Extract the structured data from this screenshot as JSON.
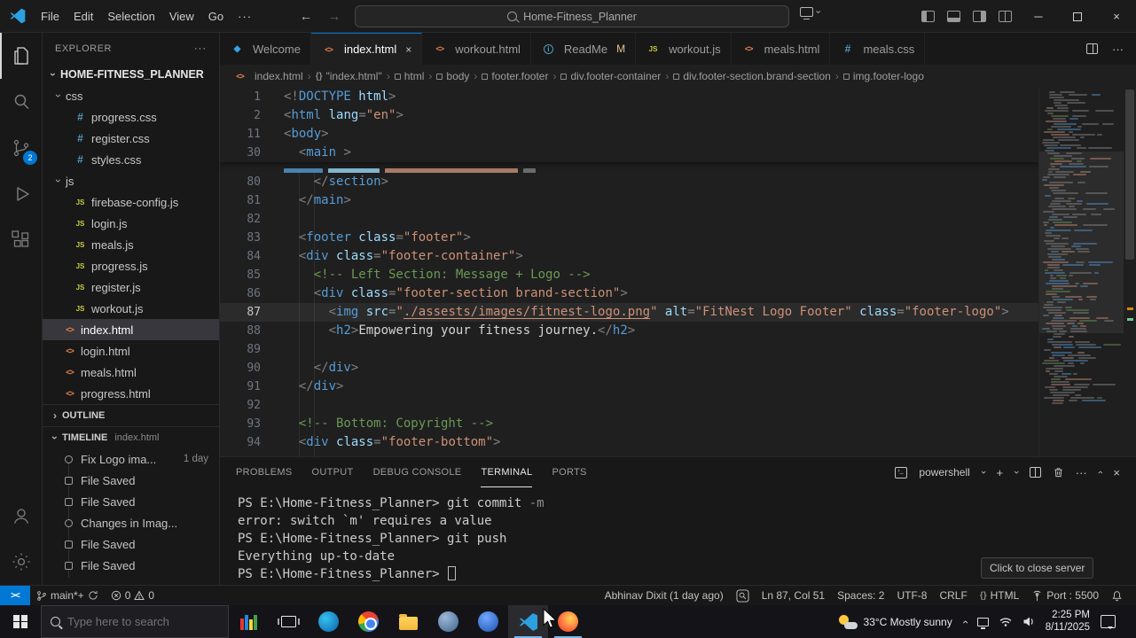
{
  "colors": {
    "accent": "#0078d4",
    "git_modified": "#e2c08d",
    "html_icon": "#e8824a",
    "css_icon": "#519aba",
    "js_icon": "#cbcb41",
    "remote_bg": "#0078d4",
    "selection_bg": "#37373d"
  },
  "titlebar": {
    "menus": [
      "File",
      "Edit",
      "Selection",
      "View",
      "Go"
    ],
    "overflow": "···",
    "back": "←",
    "forward": "→",
    "command_center": "Home-Fitness_Planner",
    "window": {
      "min": "─",
      "close": "×"
    }
  },
  "activitybar": {
    "scm_badge": "2"
  },
  "sidebar": {
    "header": "EXPLORER",
    "header_actions": "···",
    "root": "HOME-FITNESS_PLANNER",
    "files": [
      {
        "label": "css",
        "type": "folder",
        "expanded": true
      },
      {
        "label": "progress.css",
        "type": "css",
        "level": 2
      },
      {
        "label": "register.css",
        "type": "css",
        "level": 2
      },
      {
        "label": "styles.css",
        "type": "css",
        "level": 2
      },
      {
        "label": "js",
        "type": "folder",
        "expanded": true
      },
      {
        "label": "firebase-config.js",
        "type": "js",
        "level": 2
      },
      {
        "label": "login.js",
        "type": "js",
        "level": 2
      },
      {
        "label": "meals.js",
        "type": "js",
        "level": 2
      },
      {
        "label": "progress.js",
        "type": "js",
        "level": 2
      },
      {
        "label": "register.js",
        "type": "js",
        "level": 2
      },
      {
        "label": "workout.js",
        "type": "js",
        "level": 2
      },
      {
        "label": "index.html",
        "type": "html",
        "level": 1,
        "selected": true
      },
      {
        "label": "login.html",
        "type": "html",
        "level": 1
      },
      {
        "label": "meals.html",
        "type": "html",
        "level": 1
      },
      {
        "label": "progress.html",
        "type": "html",
        "level": 1
      }
    ],
    "outline_label": "OUTLINE",
    "timeline_label": "TIMELINE",
    "timeline_file": "index.html",
    "timeline_items": [
      {
        "label": "Fix Logo ima...",
        "time": "1 day",
        "icon": "commit"
      },
      {
        "label": "File Saved",
        "icon": "save"
      },
      {
        "label": "File Saved",
        "icon": "save"
      },
      {
        "label": "Changes in Imag...",
        "icon": "commit"
      },
      {
        "label": "File Saved",
        "icon": "save"
      },
      {
        "label": "File Saved",
        "icon": "save"
      }
    ]
  },
  "tabs": [
    {
      "label": "Welcome",
      "icon": "welcome"
    },
    {
      "label": "index.html",
      "icon": "html",
      "active": true,
      "close": true
    },
    {
      "label": "workout.html",
      "icon": "html"
    },
    {
      "label": "ReadMe",
      "icon": "info",
      "badge": "M"
    },
    {
      "label": "workout.js",
      "icon": "js"
    },
    {
      "label": "meals.html",
      "icon": "html"
    },
    {
      "label": "meals.css",
      "icon": "css"
    }
  ],
  "breadcrumbs": [
    {
      "icon": "html",
      "label": "index.html"
    },
    {
      "icon": "braces",
      "label": "\"index.html\""
    },
    {
      "icon": "sym",
      "label": "html"
    },
    {
      "icon": "sym",
      "label": "body"
    },
    {
      "icon": "sym",
      "label": "footer.footer"
    },
    {
      "icon": "sym",
      "label": "div.footer-container"
    },
    {
      "icon": "sym",
      "label": "div.footer-section.brand-section"
    },
    {
      "icon": "sym",
      "label": "img.footer-logo"
    }
  ],
  "editor": {
    "sticky": [
      {
        "n": "1",
        "s": [
          [
            "pt",
            "<!"
          ],
          [
            "tg",
            "DOCTYPE"
          ],
          [
            "at",
            " html"
          ],
          [
            "pt",
            ">"
          ]
        ]
      },
      {
        "n": "2",
        "s": [
          [
            "pt",
            "<"
          ],
          [
            "tg",
            "html"
          ],
          [
            "at",
            " lang"
          ],
          [
            "pt",
            "="
          ],
          [
            "st",
            "\"en\""
          ],
          [
            "pt",
            ">"
          ]
        ]
      },
      {
        "n": "11",
        "s": [
          [
            "pt",
            "<"
          ],
          [
            "tg",
            "body"
          ],
          [
            "pt",
            ">"
          ]
        ]
      },
      {
        "n": "30",
        "s": [
          [
            "tx",
            "  "
          ],
          [
            "pt",
            "<"
          ],
          [
            "tg",
            "main"
          ],
          [
            "tx",
            " "
          ],
          [
            "pt",
            ">"
          ]
        ]
      }
    ],
    "lines": [
      {
        "n": "",
        "clip": true,
        "bars": [
          [
            "#569cd6",
            44
          ],
          [
            "#9cdcfe",
            58
          ],
          [
            "#ce9178",
            150
          ],
          [
            "#808080",
            14
          ]
        ]
      },
      {
        "n": "80",
        "s": [
          [
            "tx",
            "    "
          ],
          [
            "pt",
            "</"
          ],
          [
            "tg",
            "section"
          ],
          [
            "pt",
            ">"
          ]
        ]
      },
      {
        "n": "81",
        "s": [
          [
            "tx",
            "  "
          ],
          [
            "pt",
            "</"
          ],
          [
            "tg",
            "main"
          ],
          [
            "pt",
            ">"
          ]
        ]
      },
      {
        "n": "82",
        "s": []
      },
      {
        "n": "83",
        "s": [
          [
            "tx",
            "  "
          ],
          [
            "pt",
            "<"
          ],
          [
            "tg",
            "footer"
          ],
          [
            "at",
            " class"
          ],
          [
            "pt",
            "="
          ],
          [
            "st",
            "\"footer\""
          ],
          [
            "pt",
            ">"
          ]
        ]
      },
      {
        "n": "84",
        "s": [
          [
            "tx",
            "  "
          ],
          [
            "pt",
            "<"
          ],
          [
            "tg",
            "div"
          ],
          [
            "at",
            " class"
          ],
          [
            "pt",
            "="
          ],
          [
            "st",
            "\"footer-container\""
          ],
          [
            "pt",
            ">"
          ]
        ]
      },
      {
        "n": "85",
        "s": [
          [
            "tx",
            "    "
          ],
          [
            "cm",
            "<!-- Left Section: Message + Logo -->"
          ]
        ]
      },
      {
        "n": "86",
        "s": [
          [
            "tx",
            "    "
          ],
          [
            "pt",
            "<"
          ],
          [
            "tg",
            "div"
          ],
          [
            "at",
            " class"
          ],
          [
            "pt",
            "="
          ],
          [
            "st",
            "\"footer-section brand-section\""
          ],
          [
            "pt",
            ">"
          ]
        ]
      },
      {
        "n": "87",
        "cur": true,
        "s": [
          [
            "tx",
            "      "
          ],
          [
            "pt",
            "<"
          ],
          [
            "tg",
            "img"
          ],
          [
            "at",
            " src"
          ],
          [
            "pt",
            "="
          ],
          [
            "st",
            "\""
          ],
          [
            "ln",
            "./assests/images/fitnest-logo.png"
          ],
          [
            "st",
            "\""
          ],
          [
            "at",
            " alt"
          ],
          [
            "pt",
            "="
          ],
          [
            "st",
            "\"FitNest Logo Footer\""
          ],
          [
            "at",
            " class"
          ],
          [
            "pt",
            "="
          ],
          [
            "st",
            "\"footer-logo\""
          ],
          [
            "pt",
            ">"
          ]
        ]
      },
      {
        "n": "88",
        "s": [
          [
            "tx",
            "      "
          ],
          [
            "pt",
            "<"
          ],
          [
            "tg",
            "h2"
          ],
          [
            "pt",
            ">"
          ],
          [
            "tx",
            "Empowering your fitness journey."
          ],
          [
            "pt",
            "</"
          ],
          [
            "tg",
            "h2"
          ],
          [
            "pt",
            ">"
          ]
        ]
      },
      {
        "n": "89",
        "s": []
      },
      {
        "n": "90",
        "s": [
          [
            "tx",
            "    "
          ],
          [
            "pt",
            "</"
          ],
          [
            "tg",
            "div"
          ],
          [
            "pt",
            ">"
          ]
        ]
      },
      {
        "n": "91",
        "s": [
          [
            "tx",
            "  "
          ],
          [
            "pt",
            "</"
          ],
          [
            "tg",
            "div"
          ],
          [
            "pt",
            ">"
          ]
        ]
      },
      {
        "n": "92",
        "s": []
      },
      {
        "n": "93",
        "s": [
          [
            "tx",
            "  "
          ],
          [
            "cm",
            "<!-- Bottom: Copyright -->"
          ]
        ]
      },
      {
        "n": "94",
        "s": [
          [
            "tx",
            "  "
          ],
          [
            "pt",
            "<"
          ],
          [
            "tg",
            "div"
          ],
          [
            "at",
            " class"
          ],
          [
            "pt",
            "="
          ],
          [
            "st",
            "\"footer-bottom\""
          ],
          [
            "pt",
            ">"
          ]
        ]
      }
    ]
  },
  "panel": {
    "tabs": [
      "PROBLEMS",
      "OUTPUT",
      "DEBUG CONSOLE",
      "TERMINAL",
      "PORTS"
    ],
    "active_tab": "TERMINAL",
    "shell": "powershell",
    "lines": [
      {
        "s": [
          [
            "pr",
            "PS E:\\Home-Fitness_Planner> "
          ],
          [
            "cmd",
            "git commit "
          ],
          [
            "flag",
            "-m"
          ]
        ]
      },
      {
        "s": [
          [
            "out",
            "error: switch `m' requires a value"
          ]
        ]
      },
      {
        "s": [
          [
            "pr",
            "PS E:\\Home-Fitness_Planner> "
          ],
          [
            "cmd",
            "git push"
          ]
        ]
      },
      {
        "s": [
          [
            "out",
            "Everything up-to-date"
          ]
        ]
      },
      {
        "s": [
          [
            "pr",
            "PS E:\\Home-Fitness_Planner> "
          ]
        ],
        "cursor": true
      }
    ],
    "tooltip": "Click to close server"
  },
  "statusbar": {
    "remote": "><",
    "branch": "main*+",
    "errors": "0",
    "warnings": "0",
    "author": "Abhinav Dixit (1 day ago)",
    "line_col": "Ln 87, Col 51",
    "indent": "Spaces: 2",
    "encoding": "UTF-8",
    "eol": "CRLF",
    "braces": "{}",
    "language": "HTML",
    "port": "Port : 5500"
  },
  "taskbar": {
    "search_placeholder": "Type here to search",
    "weather": "33°C Mostly sunny",
    "time": "2:25 PM",
    "date": "8/11/2025"
  }
}
